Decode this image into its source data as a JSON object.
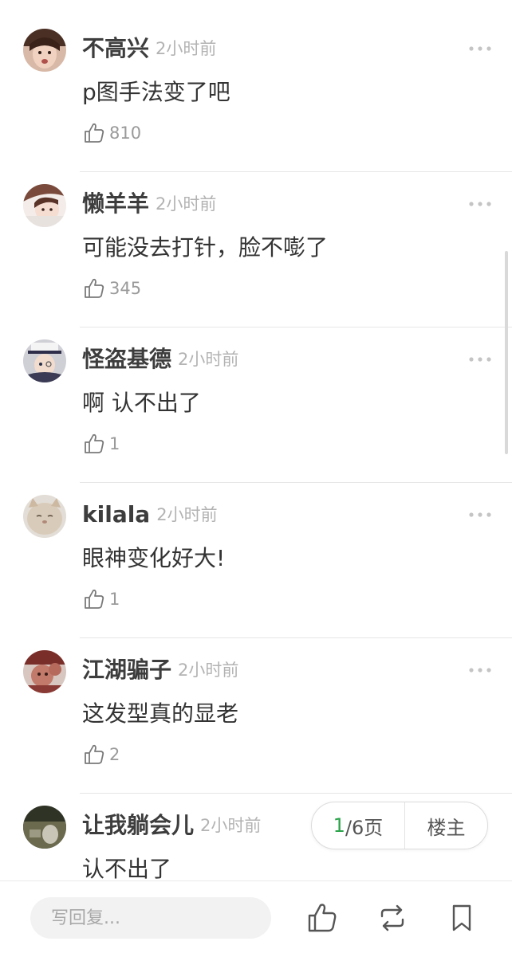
{
  "comments": [
    {
      "username": "不高兴",
      "time": "2小时前",
      "text": "p图手法变了吧",
      "likes": "810"
    },
    {
      "username": "懒羊羊",
      "time": "2小时前",
      "text": "可能没去打针，脸不嘭了",
      "likes": "345"
    },
    {
      "username": "怪盗基德",
      "time": "2小时前",
      "text": "啊 认不出了",
      "likes": "1"
    },
    {
      "username": "kilala",
      "time": "2小时前",
      "text": "眼神变化好大!",
      "likes": "1"
    },
    {
      "username": "江湖骗子",
      "time": "2小时前",
      "text": "这发型真的显老",
      "likes": "2"
    },
    {
      "username": "让我躺会儿",
      "time": "2小时前",
      "text": "认不出了",
      "likes": ""
    }
  ],
  "pager": {
    "current": "1",
    "total_label": "/6页",
    "owner_label": "楼主"
  },
  "bottom_bar": {
    "reply_placeholder": "写回复..."
  },
  "icons": {
    "like": "thumbs-up-icon",
    "more": "more-dots-icon",
    "repost": "repost-icon",
    "bookmark": "bookmark-icon"
  },
  "colors": {
    "accent_green": "#2aa34a",
    "username": "#3d3d3d",
    "meta_gray": "#b3b3b3"
  }
}
